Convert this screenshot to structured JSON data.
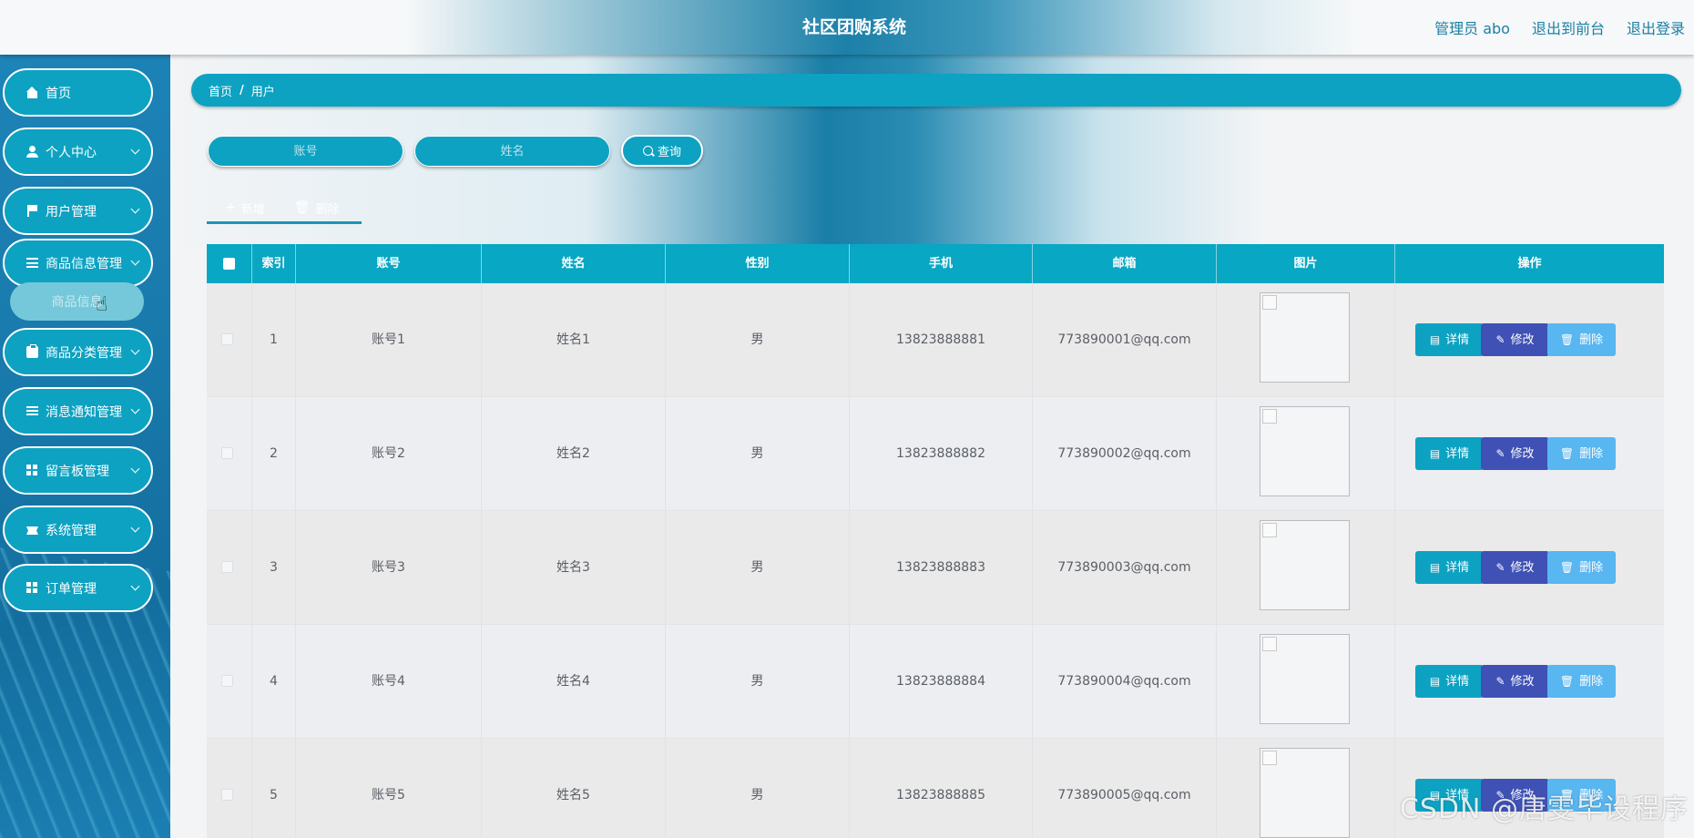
{
  "header": {
    "title": "社区团购系统",
    "user_label": "管理员 abo",
    "front_link": "退出到前台",
    "logout_link": "退出登录"
  },
  "sidebar": {
    "items": [
      {
        "label": "首页",
        "icon": "home-icon",
        "expandable": false
      },
      {
        "label": "个人中心",
        "icon": "user-icon",
        "expandable": true
      },
      {
        "label": "用户管理",
        "icon": "flag-icon",
        "expandable": true
      },
      {
        "label": "商品信息管理",
        "icon": "sliders-icon",
        "expandable": true
      },
      {
        "label": "商品分类管理",
        "icon": "clipboard-icon",
        "expandable": true
      },
      {
        "label": "消息通知管理",
        "icon": "list-icon",
        "expandable": true
      },
      {
        "label": "留言板管理",
        "icon": "grid-icon",
        "expandable": true
      },
      {
        "label": "系统管理",
        "icon": "ticket-icon",
        "expandable": true
      },
      {
        "label": "订单管理",
        "icon": "grid-icon",
        "expandable": true
      }
    ],
    "submenu_label": "商品信息"
  },
  "breadcrumb": {
    "home": "首页",
    "separator": "/",
    "current": "用户"
  },
  "search": {
    "account_placeholder": "账号",
    "name_placeholder": "姓名",
    "button_label": "查询"
  },
  "actions": {
    "add_label": "新增",
    "delete_label": "删除"
  },
  "table": {
    "columns": [
      "索引",
      "账号",
      "姓名",
      "性别",
      "手机",
      "邮箱",
      "图片",
      "操作"
    ],
    "rows": [
      {
        "index": "1",
        "account": "账号1",
        "name": "姓名1",
        "gender": "男",
        "phone": "13823888881",
        "email": "773890001@qq.com"
      },
      {
        "index": "2",
        "account": "账号2",
        "name": "姓名2",
        "gender": "男",
        "phone": "13823888882",
        "email": "773890002@qq.com"
      },
      {
        "index": "3",
        "account": "账号3",
        "name": "姓名3",
        "gender": "男",
        "phone": "13823888883",
        "email": "773890003@qq.com"
      },
      {
        "index": "4",
        "account": "账号4",
        "name": "姓名4",
        "gender": "男",
        "phone": "13823888884",
        "email": "773890004@qq.com"
      },
      {
        "index": "5",
        "account": "账号5",
        "name": "姓名5",
        "gender": "男",
        "phone": "13823888885",
        "email": "773890005@qq.com"
      }
    ],
    "row_buttons": {
      "detail": "详情",
      "edit": "修改",
      "delete": "删除"
    }
  },
  "watermark": "CSDN @唐雯毕设程序",
  "colors": {
    "accent": "#0da2c2",
    "edit": "#3f51b5",
    "delete": "#58b6f0",
    "header_text": "#1b7fa3"
  }
}
